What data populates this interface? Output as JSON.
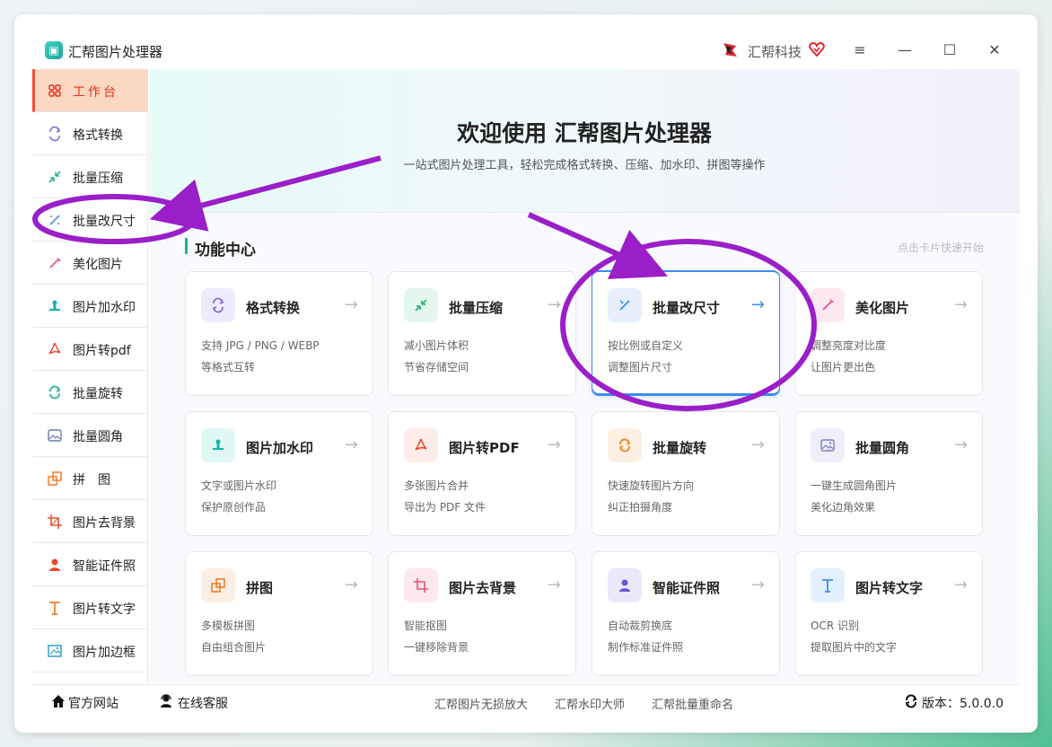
{
  "app": {
    "title": "汇帮图片处理器",
    "brand": "汇帮科技"
  },
  "window_controls": {
    "menu": "≡",
    "minimize": "—",
    "maximize": "☐",
    "close": "✕"
  },
  "sidebar": {
    "items": [
      {
        "label": "工作台",
        "icon": "grid-icon",
        "active": true
      },
      {
        "label": "格式转换",
        "icon": "convert-icon"
      },
      {
        "label": "批量压缩",
        "icon": "compress-icon"
      },
      {
        "label": "批量改尺寸",
        "icon": "resize-icon"
      },
      {
        "label": "美化图片",
        "icon": "beautify-icon"
      },
      {
        "label": "图片加水印",
        "icon": "watermark-icon"
      },
      {
        "label": "图片转pdf",
        "icon": "pdf-icon"
      },
      {
        "label": "批量旋转",
        "icon": "rotate-icon"
      },
      {
        "label": "批量圆角",
        "icon": "round-corner-icon"
      },
      {
        "label": "拼　图",
        "icon": "collage-icon"
      },
      {
        "label": "图片去背景",
        "icon": "crop-icon"
      },
      {
        "label": "智能证件照",
        "icon": "id-photo-icon"
      },
      {
        "label": "图片转文字",
        "icon": "text-icon"
      },
      {
        "label": "图片加边框",
        "icon": "frame-icon"
      }
    ]
  },
  "hero": {
    "title": "欢迎使用 汇帮图片处理器",
    "subtitle": "一站式图片处理工具，轻松完成格式转换、压缩、加水印、拼图等操作"
  },
  "section": {
    "title": "功能中心",
    "hint": "点击卡片快速开始"
  },
  "cards": [
    {
      "title": "格式转换",
      "d1": "支持 JPG / PNG / WEBP",
      "d2": "等格式互转",
      "arrow": "→"
    },
    {
      "title": "批量压缩",
      "d1": "减小图片体积",
      "d2": "节省存储空间",
      "arrow": "→"
    },
    {
      "title": "批量改尺寸",
      "d1": "按比例或自定义",
      "d2": "调整图片尺寸",
      "arrow": "→"
    },
    {
      "title": "美化图片",
      "d1": "调整亮度对比度",
      "d2": "让图片更出色",
      "arrow": "→"
    },
    {
      "title": "图片加水印",
      "d1": "文字或图片水印",
      "d2": "保护原创作品",
      "arrow": "→"
    },
    {
      "title": "图片转PDF",
      "d1": "多张图片合并",
      "d2": "导出为 PDF 文件",
      "arrow": "→"
    },
    {
      "title": "批量旋转",
      "d1": "快速旋转图片方向",
      "d2": "纠正拍摄角度",
      "arrow": "→"
    },
    {
      "title": "批量圆角",
      "d1": "一键生成圆角图片",
      "d2": "美化边角效果",
      "arrow": "→"
    },
    {
      "title": "拼图",
      "d1": "多模板拼图",
      "d2": "自由组合图片",
      "arrow": "→"
    },
    {
      "title": "图片去背景",
      "d1": "智能抠图",
      "d2": "一键移除背景",
      "arrow": "→"
    },
    {
      "title": "智能证件照",
      "d1": "自动裁剪换底",
      "d2": "制作标准证件照",
      "arrow": "→"
    },
    {
      "title": "图片转文字",
      "d1": "OCR 识别",
      "d2": "提取图片中的文字",
      "arrow": "→"
    }
  ],
  "footer": {
    "website": "官方网站",
    "service": "在线客服",
    "links": [
      "汇帮图片无损放大",
      "汇帮水印大师",
      "汇帮批量重命名"
    ],
    "version": "版本：5.0.0.0"
  },
  "colors": {
    "accent": "#f04c3a",
    "active_bg": "#fbd8c2",
    "teal": "#1ab394",
    "blue": "#3d8bf2",
    "annotation": "#9a1fc8"
  }
}
